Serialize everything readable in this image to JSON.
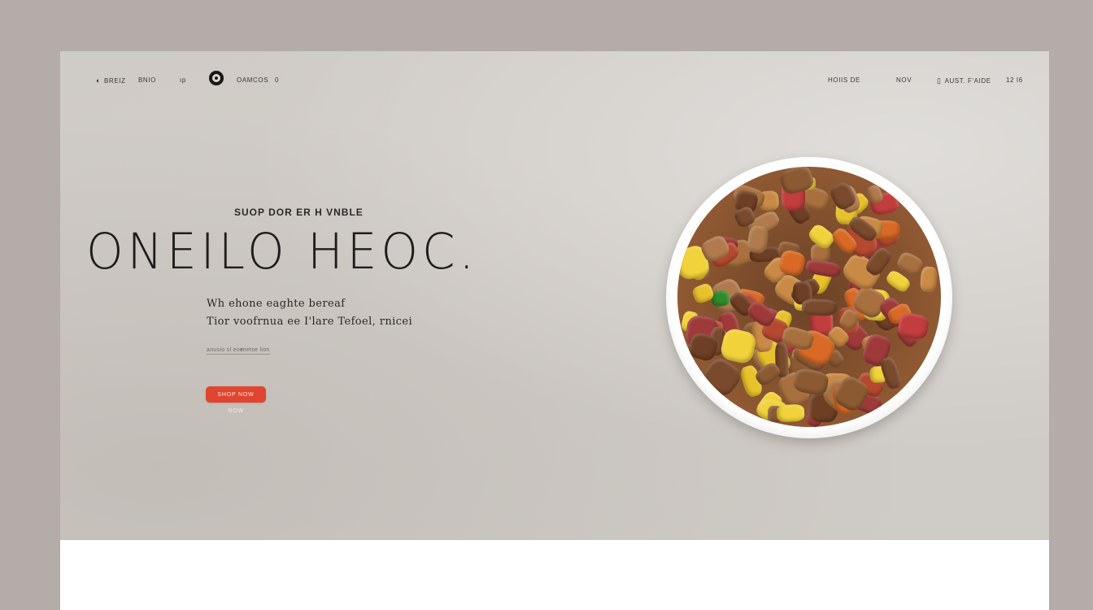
{
  "nav": {
    "brand_label": "BREIZ",
    "item_2": "BNIO",
    "item_3": "ıp",
    "logo_text": "OAMCOS",
    "logo_suffix": "0",
    "right_1": "HOIIS DE",
    "right_2": "NOV",
    "right_3": "AUST. F'AIDE",
    "right_4": "12 I6"
  },
  "hero": {
    "kicker": "SUOP DOR ER H VNBLE",
    "headline": "ONEILO HEOC.",
    "sub_line_1": "Wh ehone eaghte bereaf",
    "sub_line_2": "Tior voofrnua ee I'lare Tefoel, rnicei",
    "meta_1": "anusio sl eoe",
    "meta_2": "rnetse lion",
    "cta_label": "SHOP NOW NOW"
  },
  "colors": {
    "accent": "#e0452f",
    "background": "#cfcbc6",
    "frame": "#b4aca8"
  },
  "icons": {
    "brand": "dog-icon",
    "logo": "circle-logo-icon",
    "account": "bag-icon"
  }
}
